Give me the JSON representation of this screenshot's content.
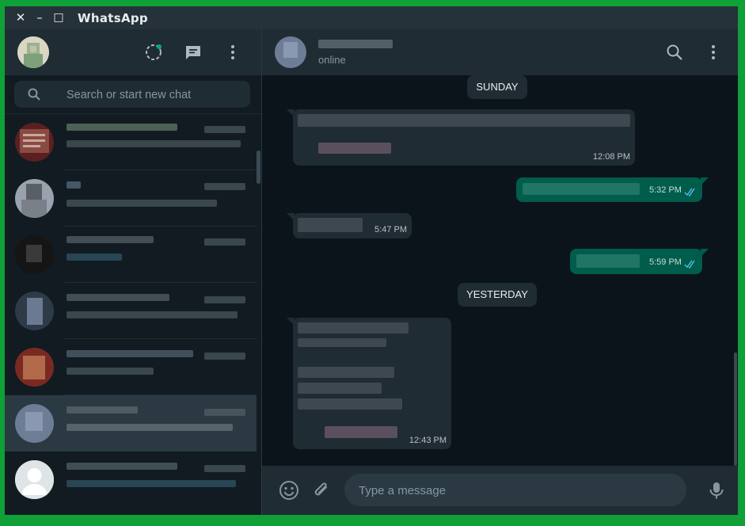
{
  "window": {
    "title": "WhatsApp",
    "close_glyph": "✕",
    "minimize_glyph": "–",
    "maximize_glyph": "□"
  },
  "sidebar": {
    "header_icons": [
      "status-icon",
      "new-chat-icon",
      "menu-icon"
    ],
    "search": {
      "placeholder": "Search or start new chat",
      "value": ""
    },
    "chats": [
      {
        "name": "",
        "preview": "",
        "time": "",
        "active": false
      },
      {
        "name": "",
        "preview": "",
        "time": "",
        "active": false
      },
      {
        "name": "",
        "preview": "",
        "time": "",
        "active": false
      },
      {
        "name": "",
        "preview": "",
        "time": "",
        "active": false
      },
      {
        "name": "",
        "preview": "",
        "time": "",
        "active": false
      },
      {
        "name": "",
        "preview": "",
        "time": "",
        "active": true
      },
      {
        "name": "",
        "preview": "",
        "time": "",
        "active": false
      }
    ]
  },
  "conversation": {
    "contact_name": "",
    "status": "online",
    "header_icons": [
      "search-icon",
      "menu-icon"
    ],
    "day_labels": {
      "sunday": "SUNDAY",
      "yesterday": "YESTERDAY"
    },
    "messages": [
      {
        "direction": "in",
        "time": "12:08 PM"
      },
      {
        "direction": "out",
        "time": "5:32 PM",
        "read": true
      },
      {
        "direction": "in",
        "time": "5:47 PM"
      },
      {
        "direction": "out",
        "time": "5:59 PM",
        "read": true
      },
      {
        "direction": "in",
        "time": "12:43 PM"
      }
    ]
  },
  "composer": {
    "placeholder": "Type a message",
    "value": "",
    "icons": [
      "emoji-icon",
      "attach-icon",
      "mic-icon"
    ]
  },
  "colors": {
    "accent": "#00a884",
    "outgoing_bubble": "#005c4b",
    "incoming_bubble": "#202c33",
    "read_ticks": "#53bdeb",
    "frame": "#0fa038"
  }
}
